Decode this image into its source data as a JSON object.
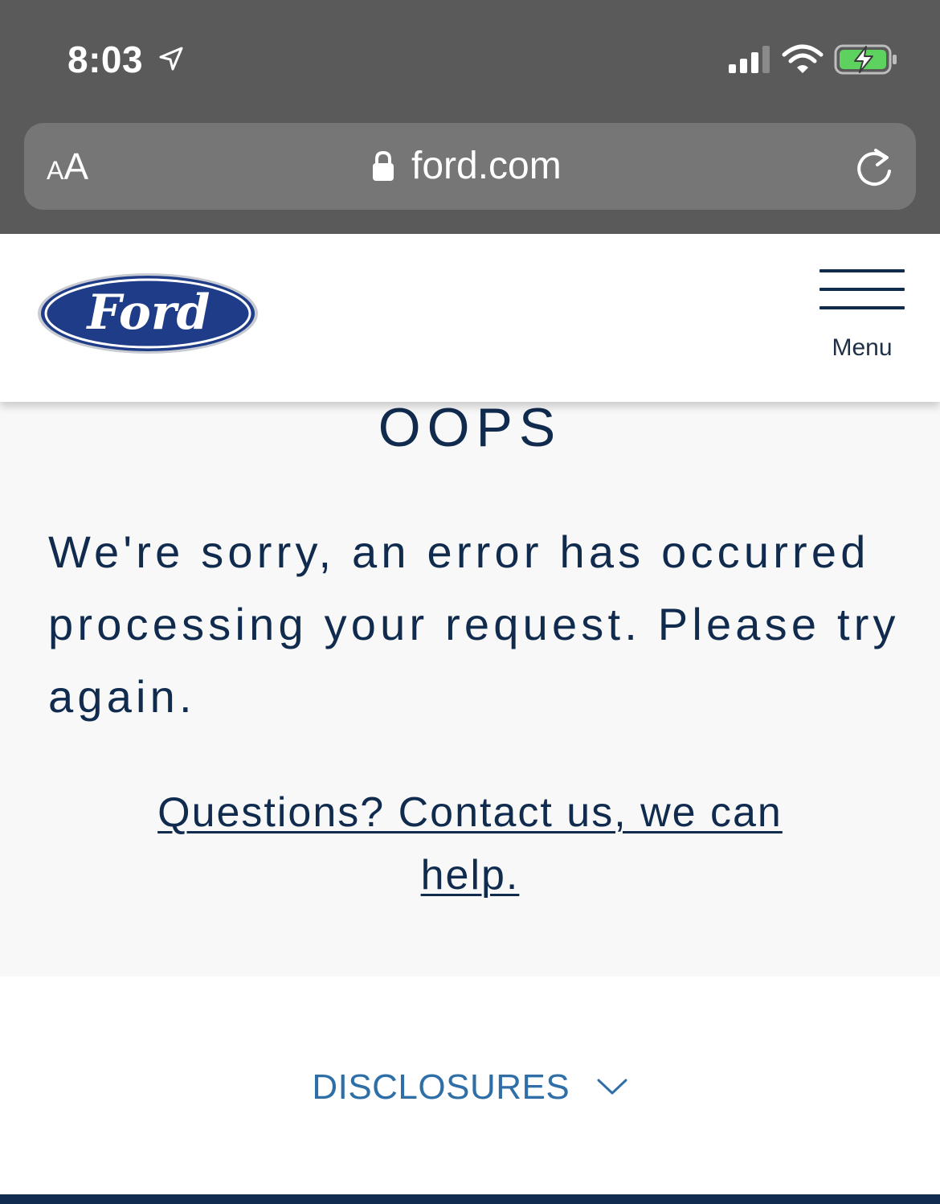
{
  "status_bar": {
    "time": "8:03",
    "icons": [
      "location-arrow-icon",
      "cellular-signal-icon",
      "wifi-icon",
      "battery-charging-icon"
    ]
  },
  "browser": {
    "text_size_small": "A",
    "text_size_large": "A",
    "url": "ford.com",
    "icons": [
      "lock-icon",
      "reload-icon"
    ]
  },
  "header": {
    "logo": "Ford",
    "menu_label": "Menu",
    "colors": {
      "logo_blue": "#1f3c88",
      "navy": "#102b4e"
    }
  },
  "error": {
    "title": "OOPS",
    "message": "We're sorry, an error has occurred processing your request. Please try again.",
    "contact_link": "Questions? Contact us, we can help."
  },
  "footer": {
    "disclosures_label": "DISCLOSURES",
    "colors": {
      "link_blue": "#2f6fa8",
      "bar": "#102b4e"
    }
  }
}
